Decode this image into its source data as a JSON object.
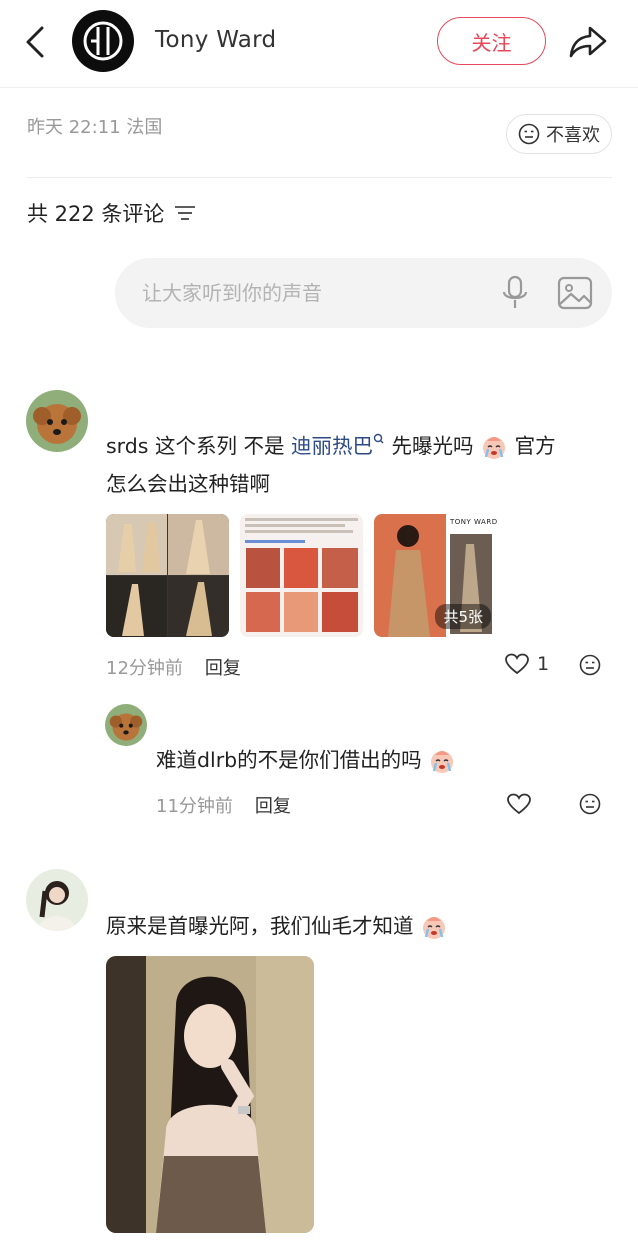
{
  "header": {
    "author_name": "Tony Ward",
    "follow_label": "关注"
  },
  "meta": {
    "time_location": "昨天 22:11 法国",
    "dislike_label": "不喜欢"
  },
  "comments_section": {
    "count_label": "共 222 条评论",
    "input_placeholder": "让大家听到你的声音"
  },
  "comments": [
    {
      "user_prefix": "srds 这个系列 不是 ",
      "mention": "迪丽热巴",
      "mid_text": " 先曝光吗",
      "suffix": " 官方",
      "line2": "怎么会出这种错啊",
      "thumbnail_badge": "共5张",
      "thumb_logo_text": "TONY WARD",
      "time": "12分钟前",
      "reply_label": "回复",
      "like_count": "1"
    },
    {
      "text": "难道dlrb的不是你们借出的吗",
      "time": "11分钟前",
      "reply_label": "回复",
      "like_count": ""
    },
    {
      "text": "原来是首曝光阿，我们仙毛才知道"
    }
  ],
  "colors": {
    "accent": "#e8485a",
    "mention": "#2d4a86"
  }
}
